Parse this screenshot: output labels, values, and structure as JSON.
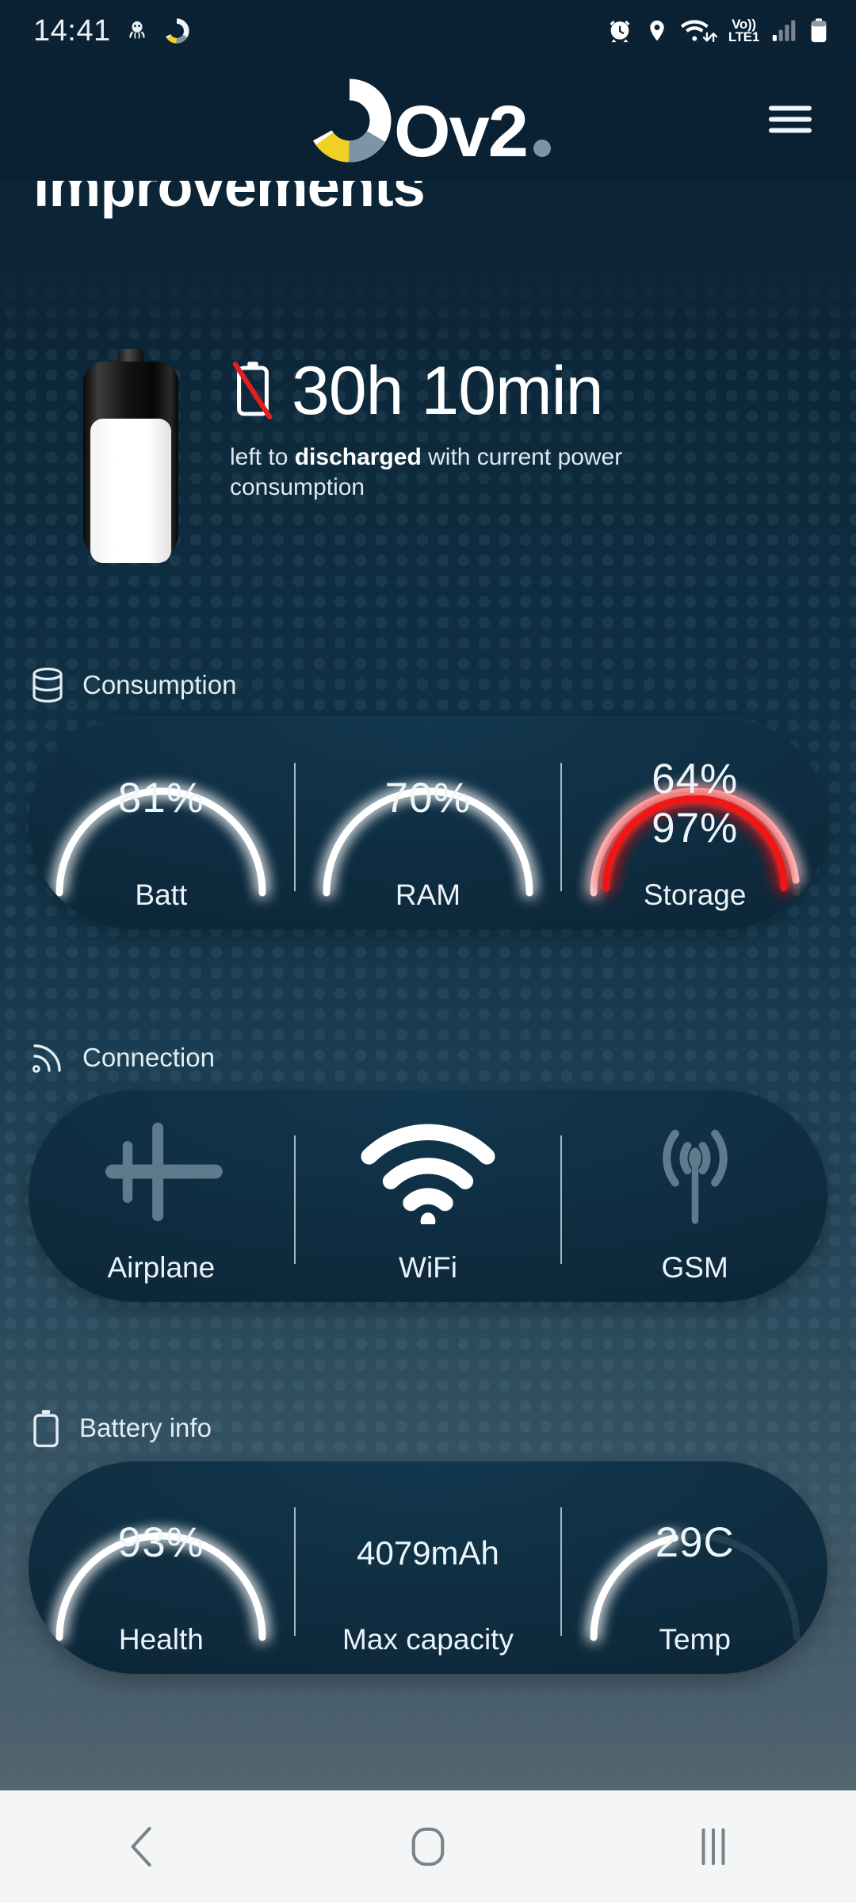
{
  "status_bar": {
    "time": "14:41",
    "left_icons": [
      "octopus-icon",
      "ov2-donut-icon"
    ],
    "right_icons": [
      "alarm-icon",
      "location-icon",
      "wifi-icon",
      "signal-icon",
      "battery-icon"
    ],
    "network_line1": "Vo))",
    "network_line2": "LTE1"
  },
  "header": {
    "logo_text": "Ov2",
    "menu_icon": "hamburger-menu-icon"
  },
  "page": {
    "title": "improvements"
  },
  "hero": {
    "no_charge_icon": "battery-not-charging-icon",
    "time_left": "30h 10min",
    "desc_prefix": "left to ",
    "desc_strong": "discharged",
    "desc_suffix": " with current power consumption",
    "battery_fill_percent": 81
  },
  "sections": [
    {
      "id": "consumption",
      "icon": "database-icon",
      "label": "Consumption",
      "cells": [
        {
          "name": "batt",
          "label": "Batt",
          "value": "81%",
          "percent": 81,
          "color": "#ffffff"
        },
        {
          "name": "ram",
          "label": "RAM",
          "value": "70%",
          "percent": 70,
          "color": "#ffffff"
        },
        {
          "name": "storage",
          "label": "Storage",
          "value": "64%",
          "percent": 64,
          "color": "#f6cfcf",
          "value2": "97%",
          "percent2": 97,
          "color2": "#f01414"
        }
      ]
    },
    {
      "id": "connection",
      "icon": "rss-signal-icon",
      "label": "Connection",
      "cells": [
        {
          "name": "airplane",
          "label": "Airplane",
          "icon": "airplane-icon",
          "active": false
        },
        {
          "name": "wifi",
          "label": "WiFi",
          "icon": "wifi-icon",
          "active": true
        },
        {
          "name": "gsm",
          "label": "GSM",
          "icon": "gsm-tower-icon",
          "active": false
        }
      ]
    },
    {
      "id": "battery-info",
      "icon": "battery-outline-icon",
      "label": "Battery info",
      "cells": [
        {
          "name": "health",
          "label": "Health",
          "value": "93%",
          "percent": 93,
          "color": "#ffffff"
        },
        {
          "name": "max-capacity",
          "label": "Max capacity",
          "value": "4079mAh",
          "percent": null
        },
        {
          "name": "temp",
          "label": "Temp",
          "value": "29C",
          "percent": 29,
          "color": "#ffffff"
        }
      ]
    }
  ],
  "nav_bar": {
    "back": "back-icon",
    "home": "home-icon",
    "recents": "recents-icon"
  },
  "colors": {
    "background_top": "#0a2134",
    "background_bottom": "#53666f",
    "card": "#0e2b3e",
    "accent_white": "#ffffff",
    "accent_red": "#f01414",
    "logo_yellow": "#f2d024",
    "logo_gray": "#7d94a4",
    "nav_bar": "#f4f5f6"
  }
}
